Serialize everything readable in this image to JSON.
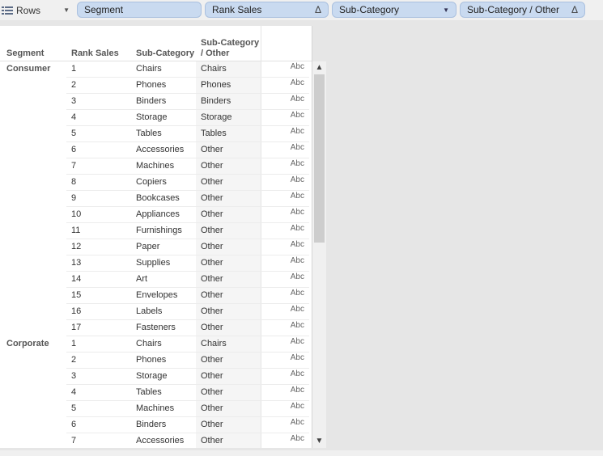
{
  "shelf": {
    "label": "Rows",
    "pills": [
      {
        "label": "Segment",
        "icon": ""
      },
      {
        "label": "Rank Sales",
        "icon": "Δ"
      },
      {
        "label": "Sub-Category",
        "icon": "caret"
      },
      {
        "label": "Sub-Category / Other",
        "icon": "Δ"
      }
    ]
  },
  "headers": {
    "segment": "Segment",
    "rank": "Rank Sales",
    "subcategory": "Sub-Category",
    "other_line1": "Sub-Category",
    "other_line2": "/ Other"
  },
  "abc": "Abc",
  "segments": [
    {
      "name": "Consumer",
      "rows": [
        {
          "rank": "1",
          "sub": "Chairs",
          "other": "Chairs"
        },
        {
          "rank": "2",
          "sub": "Phones",
          "other": "Phones"
        },
        {
          "rank": "3",
          "sub": "Binders",
          "other": "Binders"
        },
        {
          "rank": "4",
          "sub": "Storage",
          "other": "Storage"
        },
        {
          "rank": "5",
          "sub": "Tables",
          "other": "Tables"
        },
        {
          "rank": "6",
          "sub": "Accessories",
          "other": "Other"
        },
        {
          "rank": "7",
          "sub": "Machines",
          "other": "Other"
        },
        {
          "rank": "8",
          "sub": "Copiers",
          "other": "Other"
        },
        {
          "rank": "9",
          "sub": "Bookcases",
          "other": "Other"
        },
        {
          "rank": "10",
          "sub": "Appliances",
          "other": "Other"
        },
        {
          "rank": "11",
          "sub": "Furnishings",
          "other": "Other"
        },
        {
          "rank": "12",
          "sub": "Paper",
          "other": "Other"
        },
        {
          "rank": "13",
          "sub": "Supplies",
          "other": "Other"
        },
        {
          "rank": "14",
          "sub": "Art",
          "other": "Other"
        },
        {
          "rank": "15",
          "sub": "Envelopes",
          "other": "Other"
        },
        {
          "rank": "16",
          "sub": "Labels",
          "other": "Other"
        },
        {
          "rank": "17",
          "sub": "Fasteners",
          "other": "Other"
        }
      ]
    },
    {
      "name": "Corporate",
      "rows": [
        {
          "rank": "1",
          "sub": "Chairs",
          "other": "Chairs"
        },
        {
          "rank": "2",
          "sub": "Phones",
          "other": "Other"
        },
        {
          "rank": "3",
          "sub": "Storage",
          "other": "Other"
        },
        {
          "rank": "4",
          "sub": "Tables",
          "other": "Other"
        },
        {
          "rank": "5",
          "sub": "Machines",
          "other": "Other"
        },
        {
          "rank": "6",
          "sub": "Binders",
          "other": "Other"
        },
        {
          "rank": "7",
          "sub": "Accessories",
          "other": "Other"
        }
      ]
    }
  ]
}
